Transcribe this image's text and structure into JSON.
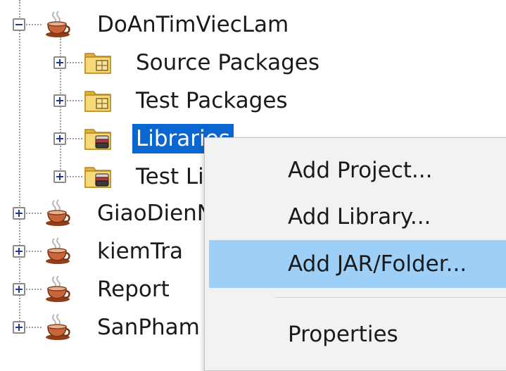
{
  "tree": {
    "root": {
      "label": "DoAnTimViecLam",
      "icon": "coffee-cup-project-icon",
      "expanded": true,
      "children": [
        {
          "label": "Source Packages",
          "icon": "package-folder-icon"
        },
        {
          "label": "Test Packages",
          "icon": "package-folder-icon"
        },
        {
          "label": "Libraries",
          "icon": "library-folder-icon",
          "selected": true
        },
        {
          "label": "Test Libraries",
          "icon": "library-folder-icon"
        }
      ]
    },
    "projects": [
      {
        "label": "GiaoDienNguoiDung",
        "icon": "coffee-cup-project-icon"
      },
      {
        "label": "kiemTra",
        "icon": "coffee-cup-project-icon"
      },
      {
        "label": "Report",
        "icon": "coffee-cup-project-icon"
      },
      {
        "label": "SanPham",
        "icon": "coffee-cup-project-icon"
      }
    ]
  },
  "context_menu": {
    "items": [
      {
        "label": "Add Project..."
      },
      {
        "label": "Add Library..."
      },
      {
        "label": "Add JAR/Folder...",
        "highlighted": true
      },
      {
        "label": "Properties"
      }
    ]
  },
  "colors": {
    "selection": "#0a66d1",
    "menu_highlight": "#9ed0f7",
    "menu_background": "#f2f2f2"
  }
}
